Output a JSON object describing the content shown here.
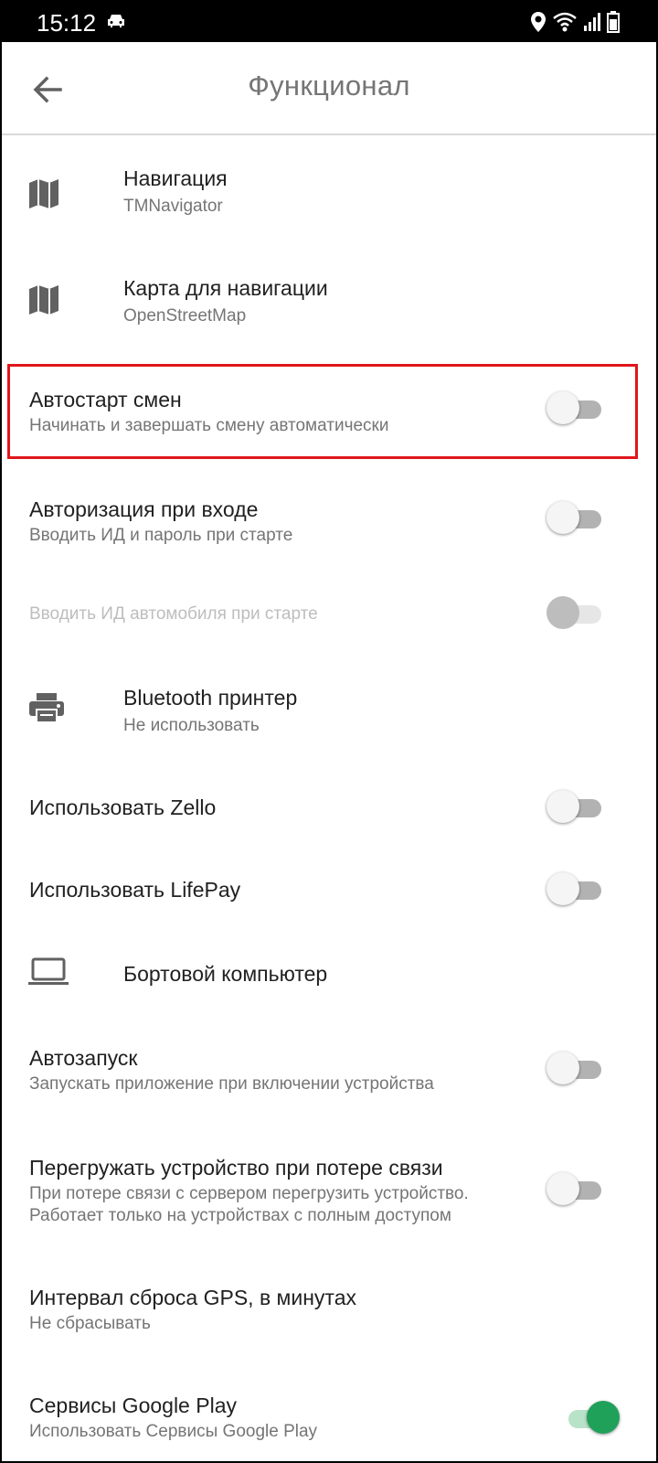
{
  "status_bar": {
    "time": "15:12",
    "icons": [
      "car-icon",
      "location-icon",
      "wifi-icon",
      "signal-icon",
      "battery-icon"
    ]
  },
  "app_bar": {
    "title": "Функционал",
    "back_icon": "arrow-back-icon"
  },
  "settings": [
    {
      "title": "Навигация",
      "subtitle": "TMNavigator",
      "icon": "map-icon"
    },
    {
      "title": "Карта для навигации",
      "subtitle": "OpenStreetMap",
      "icon": "map-icon"
    },
    {
      "title": "Автостарт смен",
      "subtitle": "Начинать и завершать смену автоматически",
      "toggle": false,
      "highlighted": true
    },
    {
      "title": "Авторизация при входе",
      "subtitle": "Вводить ИД и пароль при старте",
      "toggle": false
    },
    {
      "title": "Вводить ИД автомобиля при старте",
      "toggle": false,
      "disabled": true
    },
    {
      "title": "Bluetooth принтер",
      "subtitle": "Не использовать",
      "icon": "printer-icon"
    },
    {
      "title": "Использовать Zello",
      "toggle": false
    },
    {
      "title": "Использовать LifePay",
      "toggle": false
    },
    {
      "title": "Бортовой компьютер",
      "icon": "laptop-icon"
    },
    {
      "title": "Автозапуск",
      "subtitle": "Запускать приложение при включении устройства",
      "toggle": false
    },
    {
      "title": "Перегружать устройство при потере связи",
      "subtitle_line1": "При потере связи с сервером перегрузить устройство.",
      "subtitle_line2": "Работает только на устройствах с полным доступом",
      "toggle": false
    },
    {
      "title": "Интервал сброса GPS, в минутах",
      "subtitle": "Не сбрасывать"
    },
    {
      "title": "Сервисы Google Play",
      "subtitle": "Использовать Сервисы Google Play",
      "toggle": true
    }
  ],
  "colors": {
    "accent": "#1fa15a",
    "highlight_border": "#e0161b",
    "title": "#757575"
  }
}
